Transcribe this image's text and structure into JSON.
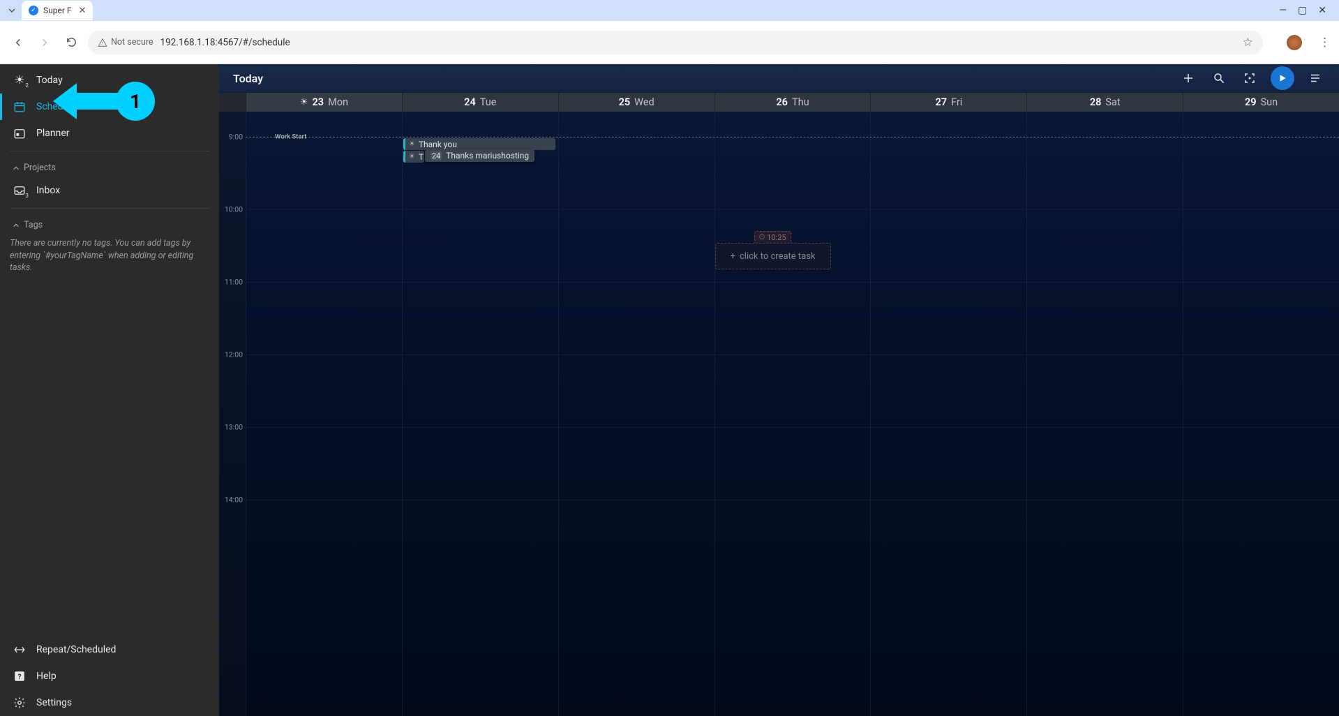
{
  "browser": {
    "tab_title": "Super F",
    "url": "192.168.1.18:4567/#/schedule",
    "security_label": "Not secure"
  },
  "sidebar": {
    "items": [
      {
        "label": "Today",
        "badge": "2"
      },
      {
        "label": "Schedule"
      },
      {
        "label": "Planner"
      }
    ],
    "projects_header": "Projects",
    "inbox_label": "Inbox",
    "inbox_badge": "3",
    "tags_header": "Tags",
    "tags_empty": "There are currently no tags. You can add tags by entering `#yourTagName` when adding or editing tasks.",
    "footer": [
      {
        "label": "Repeat/Scheduled"
      },
      {
        "label": "Help"
      },
      {
        "label": "Settings"
      }
    ]
  },
  "annotation": {
    "number": "1"
  },
  "topbar": {
    "title": "Today"
  },
  "days": [
    {
      "num": "23",
      "name": "Mon",
      "today": true
    },
    {
      "num": "24",
      "name": "Tue"
    },
    {
      "num": "25",
      "name": "Wed"
    },
    {
      "num": "26",
      "name": "Thu"
    },
    {
      "num": "27",
      "name": "Fri"
    },
    {
      "num": "28",
      "name": "Sat"
    },
    {
      "num": "29",
      "name": "Sun"
    }
  ],
  "hours": [
    "9:00",
    "10:00",
    "11:00",
    "12:00",
    "13:00",
    "14:00"
  ],
  "work_start_label": "Work Start",
  "events": {
    "tue": [
      {
        "title": "Thank you"
      },
      {
        "title": "T",
        "tooltip_date": "24",
        "tooltip_text": "Thanks mariushosting"
      }
    ]
  },
  "ghost": {
    "time": "10:25",
    "label": "click to create task"
  }
}
